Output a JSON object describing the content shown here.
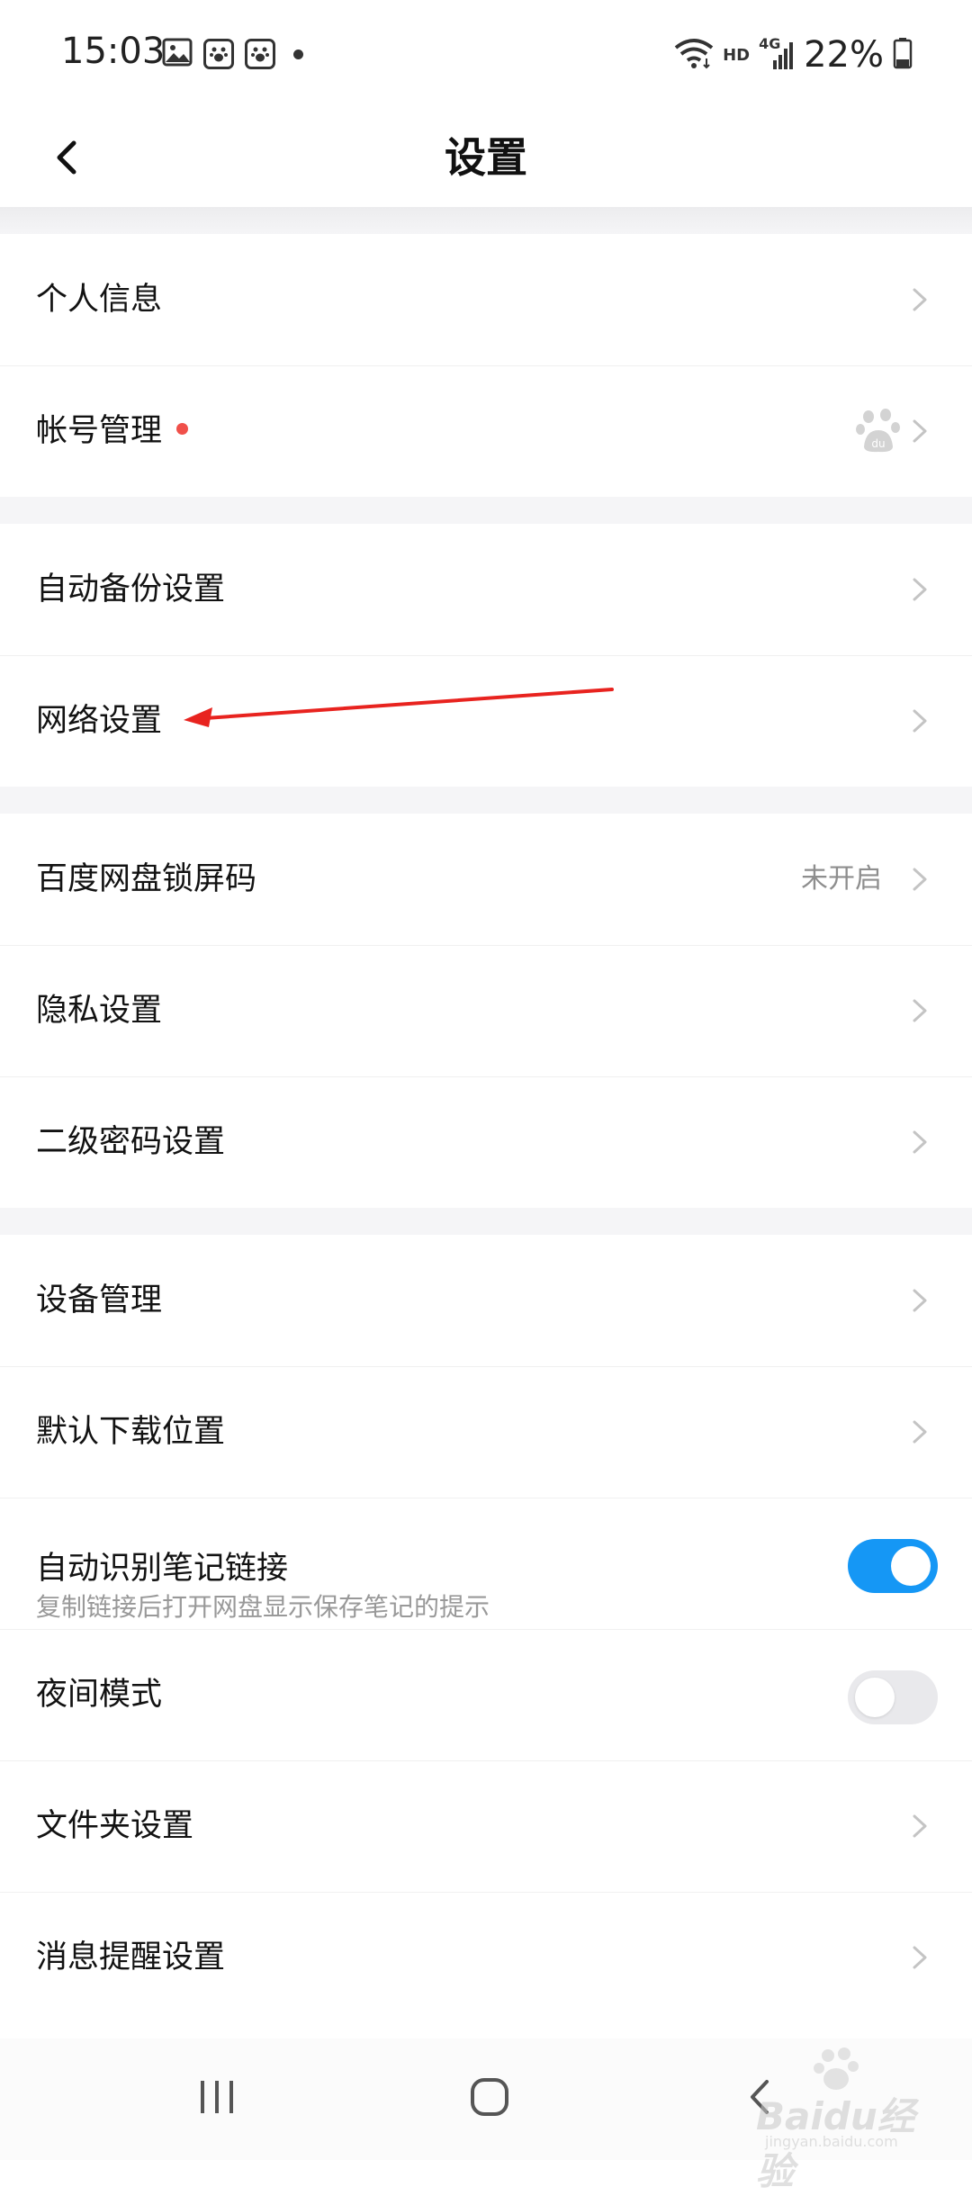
{
  "status_bar": {
    "time": "15:03",
    "left_icons": [
      "image-icon",
      "baidu-paw-icon",
      "baidu-paw-icon",
      "dot-icon"
    ],
    "network_labels": [
      "HD",
      "4G"
    ],
    "battery_percent": "22%"
  },
  "header": {
    "title": "设置"
  },
  "sections": [
    {
      "items": [
        {
          "label": "个人信息"
        },
        {
          "label": "帐号管理",
          "badge": "red-dot",
          "trailing_icon": "baidu-paw-icon"
        }
      ]
    },
    {
      "items": [
        {
          "label": "自动备份设置"
        },
        {
          "label": "网络设置"
        }
      ]
    },
    {
      "items": [
        {
          "label": "百度网盘锁屏码",
          "value": "未开启"
        },
        {
          "label": "隐私设置"
        },
        {
          "label": "二级密码设置"
        }
      ]
    },
    {
      "items": [
        {
          "label": "设备管理"
        },
        {
          "label": "默认下载位置"
        },
        {
          "label": "自动识别笔记链接",
          "sublabel": "复制链接后打开网盘显示保存笔记的提示",
          "toggle": true
        },
        {
          "label": "夜间模式",
          "toggle": false
        },
        {
          "label": "文件夹设置"
        },
        {
          "label": "消息提醒设置"
        }
      ]
    }
  ],
  "colors": {
    "accent": "#1597f5",
    "badge": "#f0504a",
    "annotation": "#e8231f",
    "section_bg": "#f5f5f7"
  },
  "watermark": {
    "text": "Baidu经验",
    "url": "jingyan.baidu.com"
  }
}
